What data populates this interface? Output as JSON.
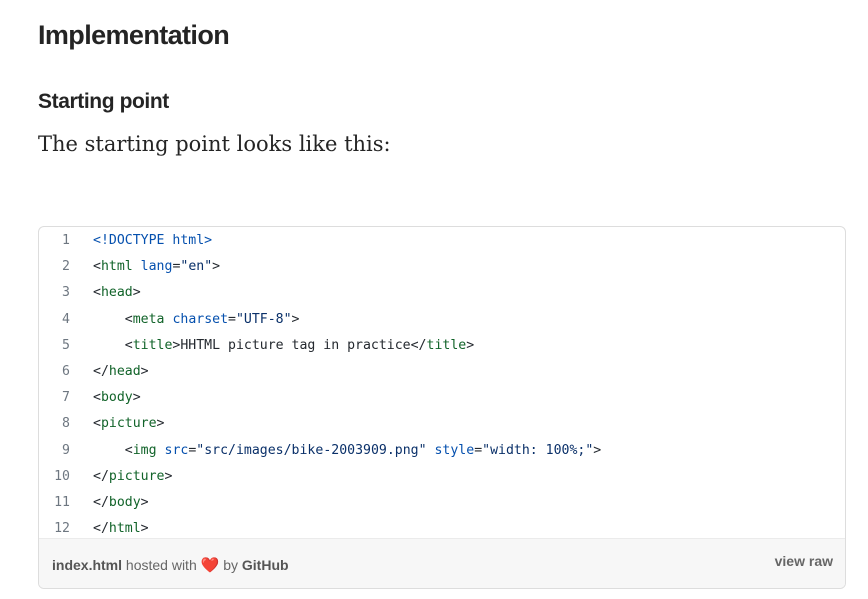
{
  "article": {
    "heading": "Implementation",
    "subheading": "Starting point",
    "paragraph": "The starting point looks like this:"
  },
  "gist": {
    "lines": [
      {
        "num": "1",
        "indent": "",
        "tokens": [
          {
            "c": "a",
            "t": "<!DOCTYPE html>"
          }
        ]
      },
      {
        "num": "2",
        "indent": "",
        "tokens": [
          {
            "c": "p",
            "t": "<"
          },
          {
            "c": "t",
            "t": "html"
          },
          {
            "c": "p",
            "t": " "
          },
          {
            "c": "a",
            "t": "lang"
          },
          {
            "c": "p",
            "t": "="
          },
          {
            "c": "s",
            "t": "\"en\""
          },
          {
            "c": "p",
            "t": ">"
          }
        ]
      },
      {
        "num": "3",
        "indent": "",
        "tokens": [
          {
            "c": "p",
            "t": "<"
          },
          {
            "c": "t",
            "t": "head"
          },
          {
            "c": "p",
            "t": ">"
          }
        ]
      },
      {
        "num": "4",
        "indent": "    ",
        "tokens": [
          {
            "c": "p",
            "t": "<"
          },
          {
            "c": "t",
            "t": "meta"
          },
          {
            "c": "p",
            "t": " "
          },
          {
            "c": "a",
            "t": "charset"
          },
          {
            "c": "p",
            "t": "="
          },
          {
            "c": "s",
            "t": "\"UTF-8\""
          },
          {
            "c": "p",
            "t": ">"
          }
        ]
      },
      {
        "num": "5",
        "indent": "    ",
        "tokens": [
          {
            "c": "p",
            "t": "<"
          },
          {
            "c": "t",
            "t": "title"
          },
          {
            "c": "p",
            "t": ">HHTML picture tag in practice</"
          },
          {
            "c": "t",
            "t": "title"
          },
          {
            "c": "p",
            "t": ">"
          }
        ]
      },
      {
        "num": "6",
        "indent": "",
        "tokens": [
          {
            "c": "p",
            "t": "</"
          },
          {
            "c": "t",
            "t": "head"
          },
          {
            "c": "p",
            "t": ">"
          }
        ]
      },
      {
        "num": "7",
        "indent": "",
        "tokens": [
          {
            "c": "p",
            "t": "<"
          },
          {
            "c": "t",
            "t": "body"
          },
          {
            "c": "p",
            "t": ">"
          }
        ]
      },
      {
        "num": "8",
        "indent": "",
        "tokens": [
          {
            "c": "p",
            "t": "<"
          },
          {
            "c": "t",
            "t": "picture"
          },
          {
            "c": "p",
            "t": ">"
          }
        ]
      },
      {
        "num": "9",
        "indent": "    ",
        "tokens": [
          {
            "c": "p",
            "t": "<"
          },
          {
            "c": "t",
            "t": "img"
          },
          {
            "c": "p",
            "t": " "
          },
          {
            "c": "a",
            "t": "src"
          },
          {
            "c": "p",
            "t": "="
          },
          {
            "c": "s",
            "t": "\"src/images/bike-2003909.png\""
          },
          {
            "c": "p",
            "t": " "
          },
          {
            "c": "a",
            "t": "style"
          },
          {
            "c": "p",
            "t": "="
          },
          {
            "c": "s",
            "t": "\"width: 100%;\""
          },
          {
            "c": "p",
            "t": ">"
          }
        ]
      },
      {
        "num": "10",
        "indent": "",
        "tokens": [
          {
            "c": "p",
            "t": "</"
          },
          {
            "c": "t",
            "t": "picture"
          },
          {
            "c": "p",
            "t": ">"
          }
        ]
      },
      {
        "num": "11",
        "indent": "",
        "tokens": [
          {
            "c": "p",
            "t": "</"
          },
          {
            "c": "t",
            "t": "body"
          },
          {
            "c": "p",
            "t": ">"
          }
        ]
      },
      {
        "num": "12",
        "indent": "",
        "tokens": [
          {
            "c": "p",
            "t": "</"
          },
          {
            "c": "t",
            "t": "html"
          },
          {
            "c": "p",
            "t": ">"
          }
        ]
      }
    ],
    "footer": {
      "filename": "index.html",
      "hosted_with": "hosted with",
      "heart": "❤️",
      "by": "by",
      "host": "GitHub",
      "view_raw": "view raw"
    },
    "colors": {
      "tag": "#116329",
      "attribute": "#0550ae",
      "string": "#0a3069",
      "plain": "#24292f",
      "line_number": "#6e7781"
    }
  }
}
